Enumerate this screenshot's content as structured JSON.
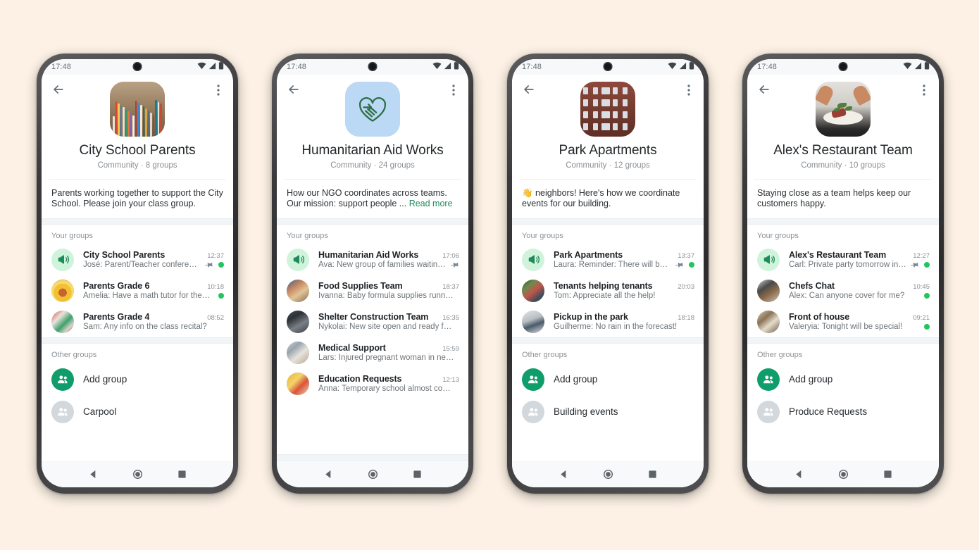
{
  "background_color": "#FCF1E4",
  "accent_green": "#0F9D6B",
  "status_dot_color": "#22C55E",
  "status_bar": {
    "time": "17:48",
    "icons": [
      "wifi-icon",
      "cellular-signal-icon",
      "battery-icon"
    ]
  },
  "nav_bar": {
    "back_label": "back-triangle",
    "home_label": "home-circle",
    "recents_label": "recents-square"
  },
  "common": {
    "your_groups_label": "Your groups",
    "other_groups_label": "Other groups",
    "add_group_label": "Add group",
    "back_icon": "arrow-left-icon",
    "menu_icon": "overflow-menu-icon",
    "pin_icon": "pin-icon",
    "announcement_icon": "megaphone-icon",
    "community_word": "Community"
  },
  "phones": [
    {
      "id": "city-school-parents",
      "avatar_art": "books",
      "title": "City School Parents",
      "subtitle": "Community · 8 groups",
      "groups_count": "8 groups",
      "description": "Parents working together to support the City School. Please join your class group.",
      "read_more": "",
      "your_groups": [
        {
          "name": "City School Parents",
          "message": "José: Parent/Teacher conferen…",
          "time": "12:37",
          "avatar": "announcement",
          "pinned": true,
          "unread_dot": true
        },
        {
          "name": "Parents Grade 6",
          "message": "Amelia: Have a math tutor for the…",
          "time": "10:18",
          "avatar": "ph-turkey",
          "pinned": false,
          "unread_dot": true
        },
        {
          "name": "Parents Grade 4",
          "message": "Sam: Any info on the class recital?",
          "time": "08:52",
          "avatar": "ph-supplies",
          "pinned": false,
          "unread_dot": false
        }
      ],
      "other_groups": [
        "Carpool"
      ]
    },
    {
      "id": "humanitarian-aid-works",
      "avatar_art": "ngo",
      "title": "Humanitarian Aid Works",
      "subtitle": "Community · 24 groups",
      "groups_count": "24 groups",
      "description": "How our NGO coordinates across teams. Our mission: support people ... ",
      "read_more": "Read more",
      "your_groups": [
        {
          "name": "Humanitarian Aid Works",
          "message": "Ava: New group of families waitin…",
          "time": "17:06",
          "avatar": "announcement",
          "pinned": true,
          "unread_dot": false
        },
        {
          "name": "Food Supplies Team",
          "message": "Ivanna: Baby formula supplies running …",
          "time": "18:37",
          "avatar": "ph-food-team",
          "pinned": false,
          "unread_dot": false
        },
        {
          "name": "Shelter Construction Team",
          "message": "Nykolai: New site open and ready for …",
          "time": "16:35",
          "avatar": "ph-shelter",
          "pinned": false,
          "unread_dot": false
        },
        {
          "name": "Medical Support",
          "message": "Lars: Injured pregnant woman in need…",
          "time": "15:59",
          "avatar": "ph-medical",
          "pinned": false,
          "unread_dot": false
        },
        {
          "name": "Education Requests",
          "message": "Anna: Temporary school almost comp…",
          "time": "12:13",
          "avatar": "ph-education",
          "pinned": false,
          "unread_dot": false
        }
      ],
      "other_groups": []
    },
    {
      "id": "park-apartments",
      "avatar_art": "bldg",
      "title": "Park Apartments",
      "subtitle": "Community · 12 groups",
      "groups_count": "12 groups",
      "description": "👋 neighbors! Here's how we coordinate events for our building.",
      "read_more": "",
      "your_groups": [
        {
          "name": "Park Apartments",
          "message": "Laura: Reminder: There will be…",
          "time": "13:37",
          "avatar": "announcement",
          "pinned": true,
          "unread_dot": true
        },
        {
          "name": "Tenants helping tenants",
          "message": "Tom: Appreciate all the help!",
          "time": "20:03",
          "avatar": "ph-tenants",
          "pinned": false,
          "unread_dot": false
        },
        {
          "name": "Pickup in the park",
          "message": "Guilherme: No rain in the forecast!",
          "time": "18:18",
          "avatar": "ph-park",
          "pinned": false,
          "unread_dot": false
        }
      ],
      "other_groups": [
        "Building events"
      ]
    },
    {
      "id": "alexs-restaurant-team",
      "avatar_art": "food",
      "title": "Alex's Restaurant Team",
      "subtitle": "Community · 10 groups",
      "groups_count": "10 groups",
      "description": "Staying close as a team helps keep our customers happy.",
      "read_more": "",
      "your_groups": [
        {
          "name": "Alex's Restaurant Team",
          "message": "Carl: Private party tomorrow in…",
          "time": "12:27",
          "avatar": "announcement",
          "pinned": true,
          "unread_dot": true
        },
        {
          "name": "Chefs Chat",
          "message": "Alex: Can anyone cover for me?",
          "time": "10:45",
          "avatar": "ph-chefs",
          "pinned": false,
          "unread_dot": true
        },
        {
          "name": "Front of house",
          "message": "Valeryia: Tonight will be special!",
          "time": "09:21",
          "avatar": "ph-front",
          "pinned": false,
          "unread_dot": true
        }
      ],
      "other_groups": [
        "Produce Requests"
      ]
    }
  ]
}
